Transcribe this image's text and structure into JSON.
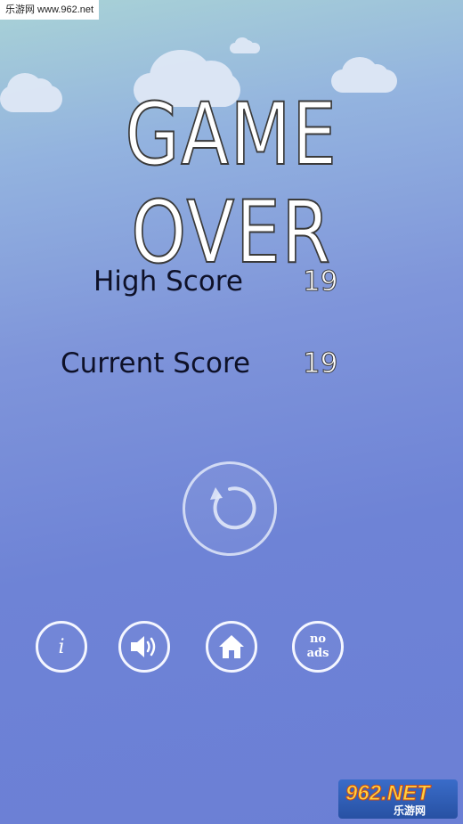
{
  "watermark": {
    "top": "乐游网 www.962.net",
    "bottom_logo": "962.NET",
    "bottom_sub": "乐游网"
  },
  "title": "GAME OVER",
  "scores": {
    "high_label": "High Score",
    "high_value": "19",
    "current_label": "Current Score",
    "current_value": "19"
  },
  "buttons": {
    "replay": "replay-icon",
    "info": "i",
    "sound": "speaker-icon",
    "home": "home-icon",
    "noads_line1": "no",
    "noads_line2": "ads"
  },
  "colors": {
    "background": "#6e83d6",
    "label": "#0e1128",
    "accent": "#ffffff"
  }
}
